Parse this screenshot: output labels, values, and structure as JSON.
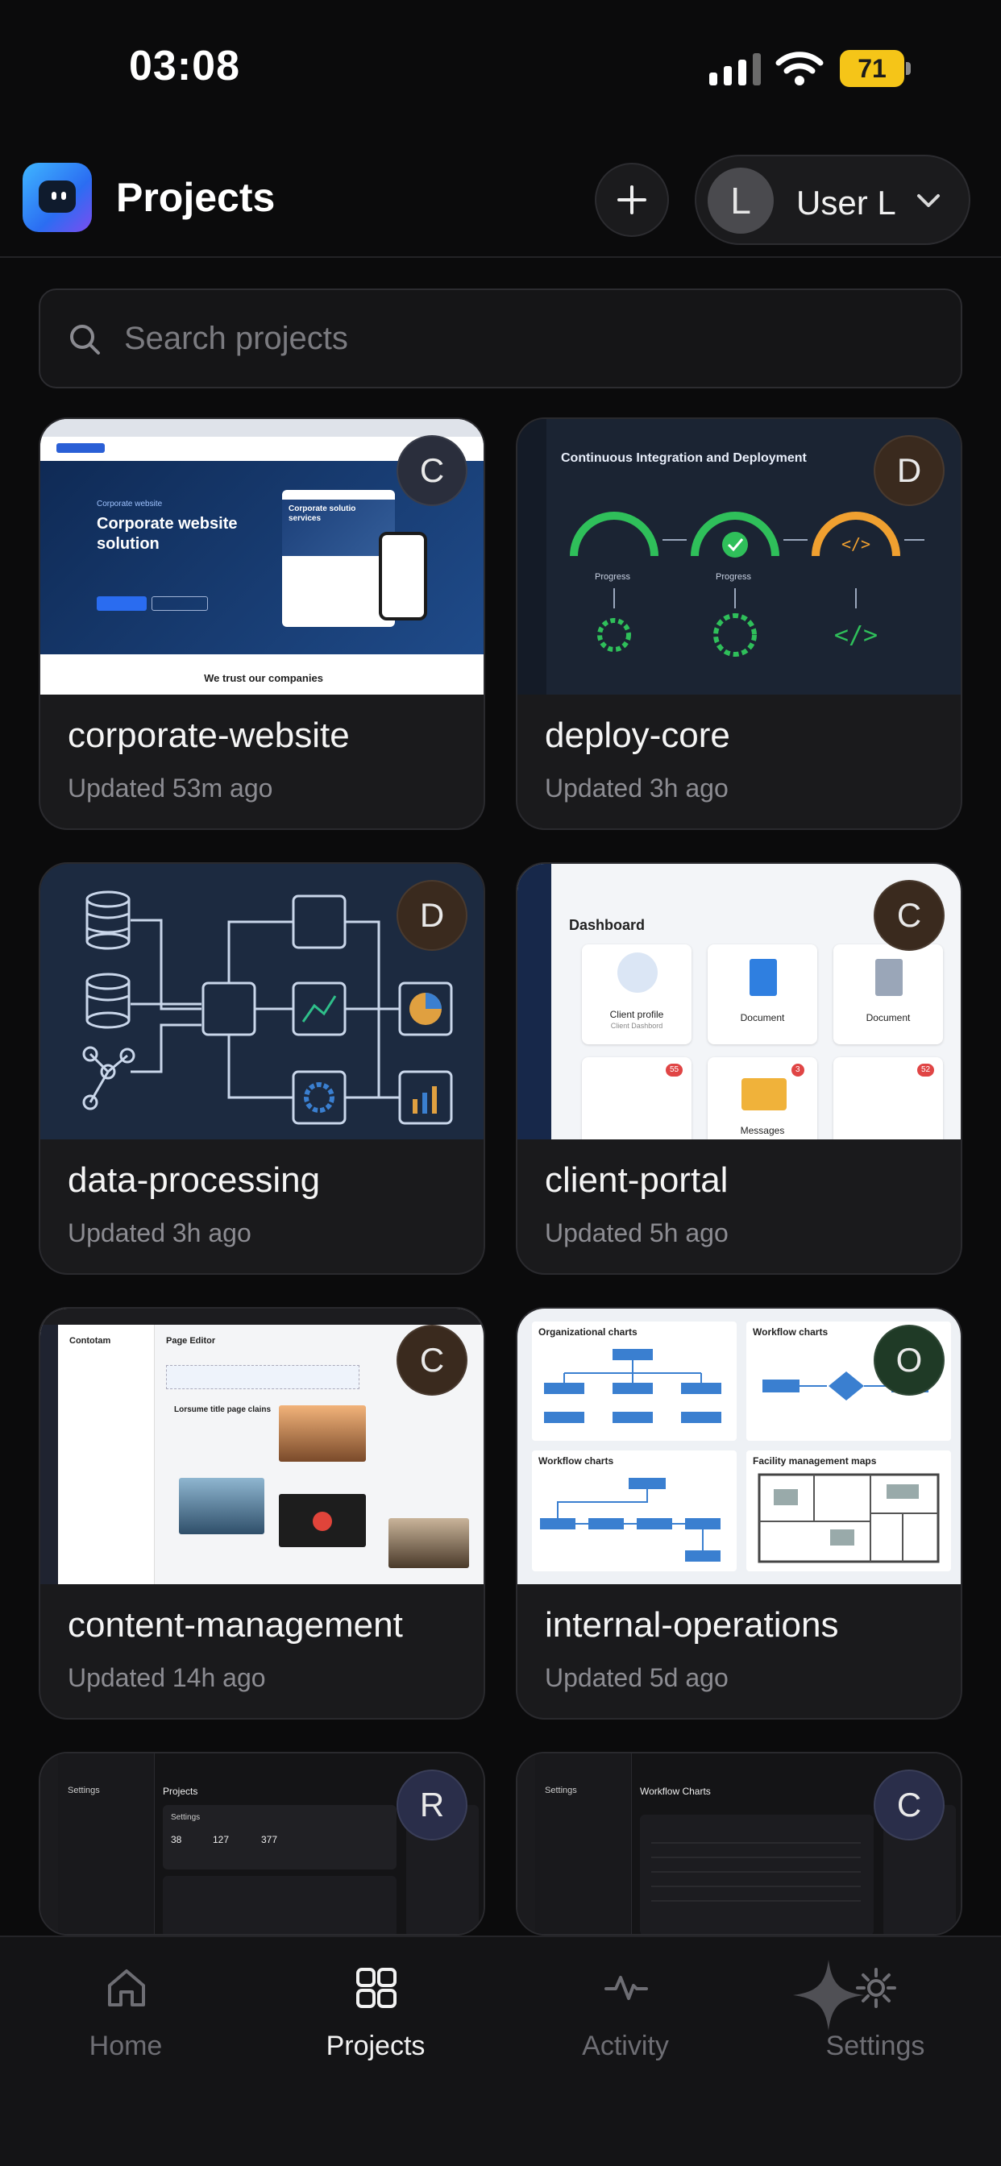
{
  "status_bar": {
    "time": "03:08",
    "battery": "71"
  },
  "header": {
    "title": "Projects",
    "user_initial": "L",
    "user_name": "User L"
  },
  "search": {
    "placeholder": "Search projects"
  },
  "colors": {
    "background": "#0b0b0c",
    "card": "#1a1a1c",
    "accent_battery": "#f5c518"
  },
  "projects": [
    {
      "name": "corporate-website",
      "updated": "Updated 53m ago",
      "badge": "C",
      "badge_color": "#2a2e3c",
      "thumb": {
        "kicker": "Corporate website",
        "headline": "Corporate website solution",
        "footer": "We trust our companies",
        "mini_headline": "Corporate solutio\nservices"
      }
    },
    {
      "name": "deploy-core",
      "updated": "Updated 3h ago",
      "badge": "D",
      "badge_color": "#3a2a1e",
      "thumb": {
        "title": "Continuous Integration and Deployment",
        "gauge_label": "Progress"
      }
    },
    {
      "name": "data-processing",
      "updated": "Updated 3h ago",
      "badge": "D",
      "badge_color": "#3a2a1e"
    },
    {
      "name": "client-portal",
      "updated": "Updated 5h ago",
      "badge": "C",
      "badge_color": "#3a2a1e",
      "thumb": {
        "title": "Dashboard",
        "tile1_title": "Client profile",
        "tile1_sub": "Client Dashbord",
        "tile2": "Document",
        "tile3": "Document",
        "tile4": "Messages",
        "count1": "55",
        "count2": "3",
        "count3": "52"
      }
    },
    {
      "name": "content-management",
      "updated": "Updated 14h ago",
      "badge": "C",
      "badge_color": "#3a2a1e",
      "thumb": {
        "brand": "Contotam",
        "title": "Page Editor",
        "headline": "Lorsume title page clains"
      }
    },
    {
      "name": "internal-operations",
      "updated": "Updated 5d ago",
      "badge": "O",
      "badge_color": "#1f3a26",
      "thumb": {
        "q1": "Organizational charts",
        "q2": "Workflow charts",
        "q3": "Workflow charts",
        "q4": "Facility management maps"
      }
    },
    {
      "name": "",
      "updated": "",
      "badge": "R",
      "badge_color": "#2a2e4a",
      "thumb": {
        "side_title": "Settings",
        "main_title": "Projects",
        "panel": "Settings",
        "stat1": "38",
        "stat2": "127",
        "stat3": "377"
      }
    },
    {
      "name": "",
      "updated": "",
      "badge": "C",
      "badge_color": "#2a2e4a",
      "thumb": {
        "side_title": "Settings",
        "main_title": "Workflow Charts"
      }
    }
  ],
  "tabbar": [
    {
      "label": "Home",
      "icon": "home-icon",
      "active": false
    },
    {
      "label": "Projects",
      "icon": "grid-icon",
      "active": true
    },
    {
      "label": "Activity",
      "icon": "activity-icon",
      "active": false
    },
    {
      "label": "Settings",
      "icon": "gear-icon",
      "active": false
    }
  ]
}
